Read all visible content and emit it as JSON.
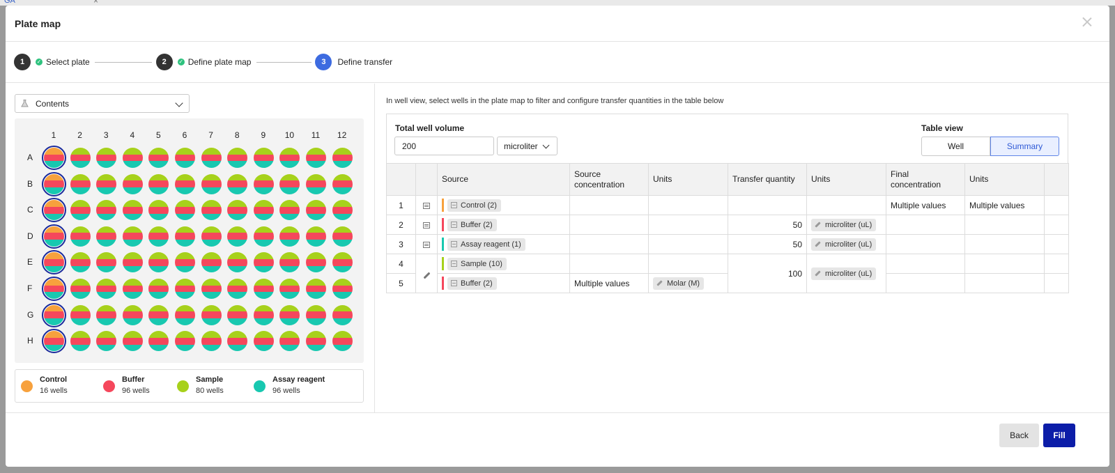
{
  "background": {
    "tab_fragment": "GA"
  },
  "modal": {
    "title": "Plate map"
  },
  "steps": [
    {
      "num": "1",
      "label": "Select plate",
      "done": true
    },
    {
      "num": "2",
      "label": "Define plate map",
      "done": true
    },
    {
      "num": "3",
      "label": "Define transfer",
      "active": true
    }
  ],
  "left": {
    "contents_select": "Contents"
  },
  "plate": {
    "columns": [
      "1",
      "2",
      "3",
      "4",
      "5",
      "6",
      "7",
      "8",
      "9",
      "10",
      "11",
      "12"
    ],
    "rows": [
      "A",
      "B",
      "C",
      "D",
      "E",
      "F",
      "G",
      "H"
    ],
    "selected_column": "1"
  },
  "legend": [
    {
      "name": "Control",
      "count": "16 wells",
      "color": "#f7a13d"
    },
    {
      "name": "Buffer",
      "count": "96 wells",
      "color": "#f5475c"
    },
    {
      "name": "Sample",
      "count": "80 wells",
      "color": "#a7d11b"
    },
    {
      "name": "Assay reagent",
      "count": "96 wells",
      "color": "#18c8b0"
    }
  ],
  "right": {
    "hint": "In well view, select wells in the plate map to filter and configure transfer quantities in the table below",
    "total_well_volume_label": "Total well volume",
    "total_well_volume": "200",
    "volume_unit": "microliter",
    "table_view_label": "Table view",
    "table_view_options": [
      "Well",
      "Summary"
    ],
    "table_view_selected": "Summary"
  },
  "table": {
    "headers": [
      "",
      "",
      "Source",
      "Source concentration",
      "Units",
      "Transfer quantity",
      "Units",
      "Final concentration",
      "Units",
      ""
    ],
    "rows": [
      {
        "num": "1",
        "source": "Control (2)",
        "color": "#f7a13d",
        "src_conc": "",
        "src_units": "",
        "transfer": "",
        "transfer_units": "",
        "final_conc": "Multiple values",
        "final_units": "Multiple values"
      },
      {
        "num": "2",
        "source": "Buffer (2)",
        "color": "#f5475c",
        "src_conc": "",
        "src_units": "",
        "transfer": "50",
        "transfer_units": "microliter (uL)",
        "final_conc": "",
        "final_units": ""
      },
      {
        "num": "3",
        "source": "Assay reagent (1)",
        "color": "#18c8b0",
        "src_conc": "",
        "src_units": "",
        "transfer": "50",
        "transfer_units": "microliter (uL)",
        "final_conc": "",
        "final_units": ""
      },
      {
        "num": "4",
        "source": "Sample (10)",
        "color": "#a7d11b",
        "src_conc": "",
        "src_units": "",
        "final_conc": "",
        "final_units": ""
      },
      {
        "num": "5",
        "source": "Buffer (2)",
        "color": "#f5475c",
        "src_conc": "Multiple values",
        "src_units": "Molar (M)",
        "final_conc": "",
        "final_units": ""
      }
    ],
    "merged_transfer": "100",
    "merged_transfer_units": "microliter (uL)"
  },
  "footer": {
    "back_label": "Back",
    "fill_label": "Fill"
  }
}
